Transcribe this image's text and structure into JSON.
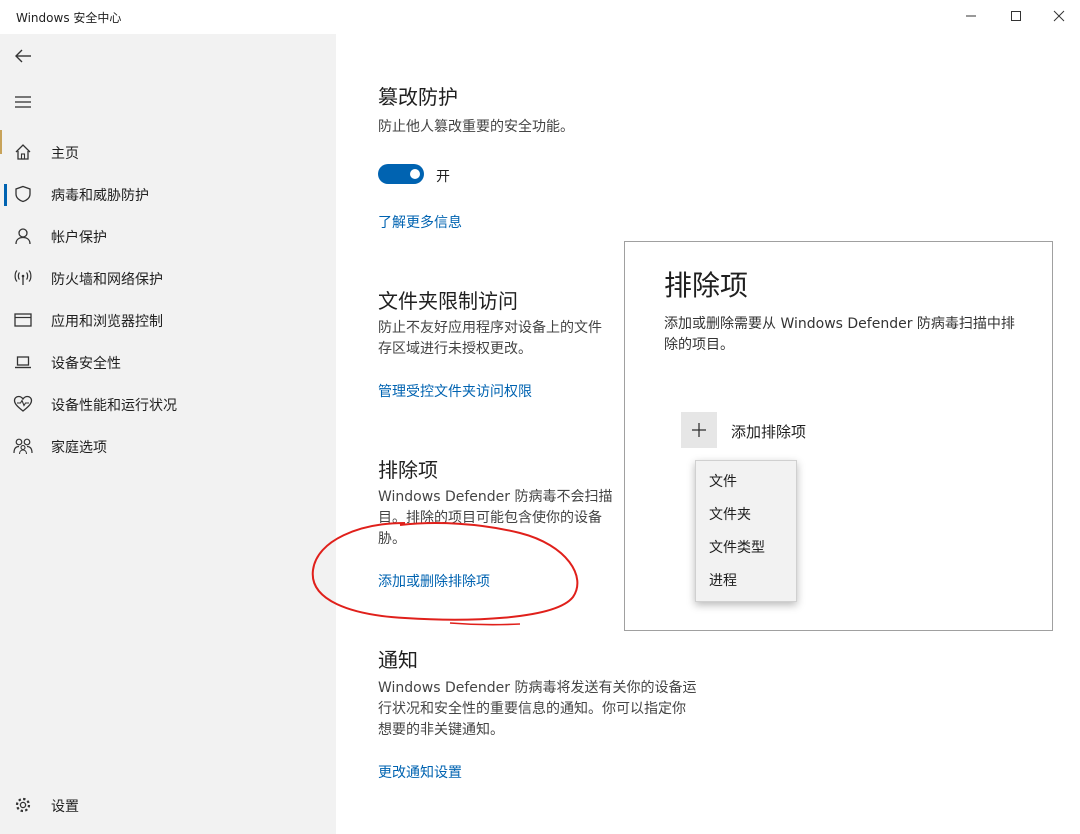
{
  "window": {
    "title": "Windows 安全中心"
  },
  "sidebar": {
    "items": [
      {
        "label": "主页",
        "icon": "home-icon"
      },
      {
        "label": "病毒和威胁防护",
        "icon": "shield-icon",
        "active": true
      },
      {
        "label": "帐户保护",
        "icon": "person-icon"
      },
      {
        "label": "防火墙和网络保护",
        "icon": "wireless-icon"
      },
      {
        "label": "应用和浏览器控制",
        "icon": "browser-window-icon"
      },
      {
        "label": "设备安全性",
        "icon": "laptop-icon"
      },
      {
        "label": "设备性能和运行状况",
        "icon": "heart-icon"
      },
      {
        "label": "家庭选项",
        "icon": "family-icon"
      }
    ],
    "settings_label": "设置"
  },
  "main": {
    "tamper": {
      "title": "篡改防护",
      "desc": "防止他人篡改重要的安全功能。",
      "toggle_label": "开",
      "toggle_on": true,
      "link": "了解更多信息"
    },
    "folder": {
      "title": "文件夹限制访问",
      "desc_line1": "防止不友好应用程序对设备上的文件",
      "desc_line2": "存区域进行未授权更改。",
      "link": "管理受控文件夹访问权限"
    },
    "exclusions": {
      "title": "排除项",
      "desc_line1": "Windows Defender 防病毒不会扫描",
      "desc_line2": "目。排除的项目可能包含使你的设备",
      "desc_line3": "胁。",
      "link": "添加或删除排除项"
    },
    "notify": {
      "title": "通知",
      "desc_line1": "Windows Defender 防病毒将发送有关你的设备运",
      "desc_line2": "行状况和安全性的重要信息的通知。你可以指定你",
      "desc_line3": "想要的非关键通知。",
      "link": "更改通知设置"
    }
  },
  "panel": {
    "title": "排除项",
    "desc": "添加或删除需要从 Windows Defender 防病毒扫描中排除的项目。",
    "add_label": "添加排除项",
    "menu": [
      "文件",
      "文件夹",
      "文件类型",
      "进程"
    ]
  },
  "colors": {
    "accent": "#0063b1",
    "sidebar_bg": "#f2f2f2",
    "annotation": "#e0201b"
  }
}
